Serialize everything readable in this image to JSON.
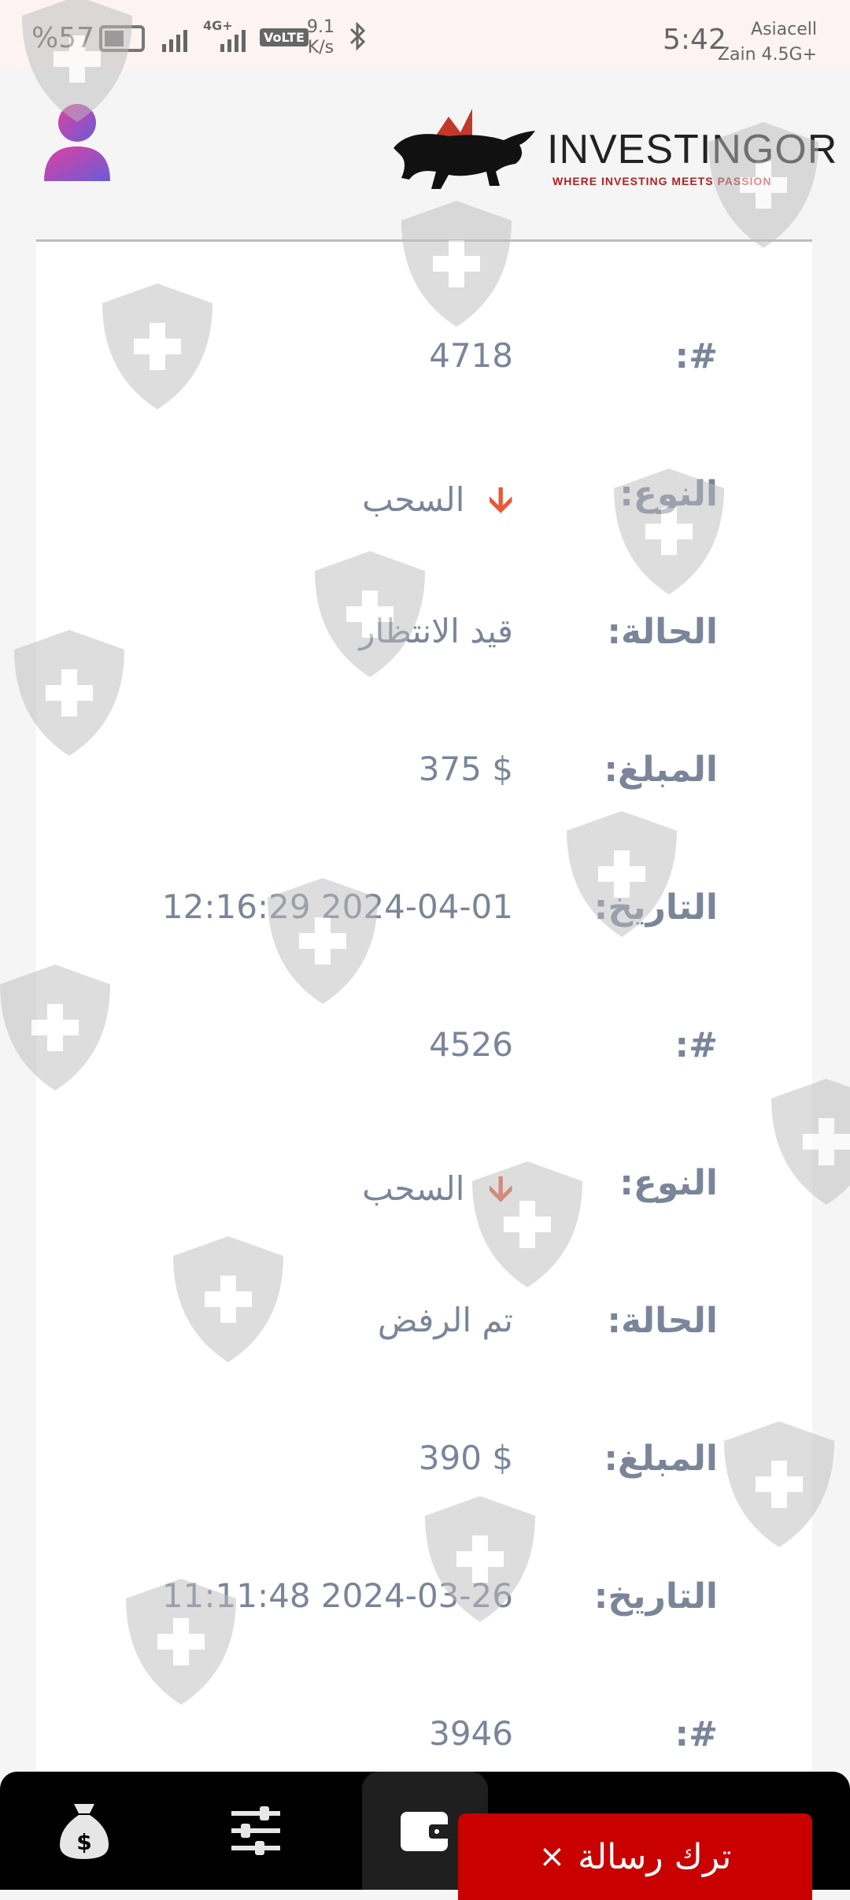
{
  "status_bar": {
    "battery": "%57",
    "network_type": "4G+",
    "volte": "VoLTE",
    "speed_value": "9.1",
    "speed_unit": "K/s",
    "time": "5:42",
    "carrier_1": "Asiacell",
    "carrier_2": "Zain 4.5G+"
  },
  "header": {
    "brand_name": "INVESTINGOR",
    "brand_tagline": "WHERE INVESTING MEETS PASSION"
  },
  "transactions": [
    {
      "id_label": "#:",
      "id": "4718",
      "type_label": "النوع:",
      "type": "السحب",
      "status_label": "الحالة:",
      "status": "قيد الانتظار",
      "amount_label": "المبلغ:",
      "amount": "375 $",
      "date_label": "التاريخ:",
      "date": "12:16:29 2024-04-01"
    },
    {
      "id_label": "#:",
      "id": "4526",
      "type_label": "النوع:",
      "type": "السحب",
      "status_label": "الحالة:",
      "status": "تم الرفض",
      "amount_label": "المبلغ:",
      "amount": "390 $",
      "date_label": "التاريخ:",
      "date": "11:11:48 2024-03-26"
    },
    {
      "id_label": "#:",
      "id": "3946"
    }
  ],
  "colors": {
    "label_color": "#7a8599",
    "withdraw_arrow": "#e85a36",
    "message_button": "#c80000"
  },
  "bottom_nav": {
    "items": [
      "money-bag-icon",
      "sliders-icon",
      "wallet-icon"
    ],
    "active": "wallet-icon"
  },
  "message_button": {
    "label": "ترك رسالة",
    "close_symbol": "×"
  }
}
